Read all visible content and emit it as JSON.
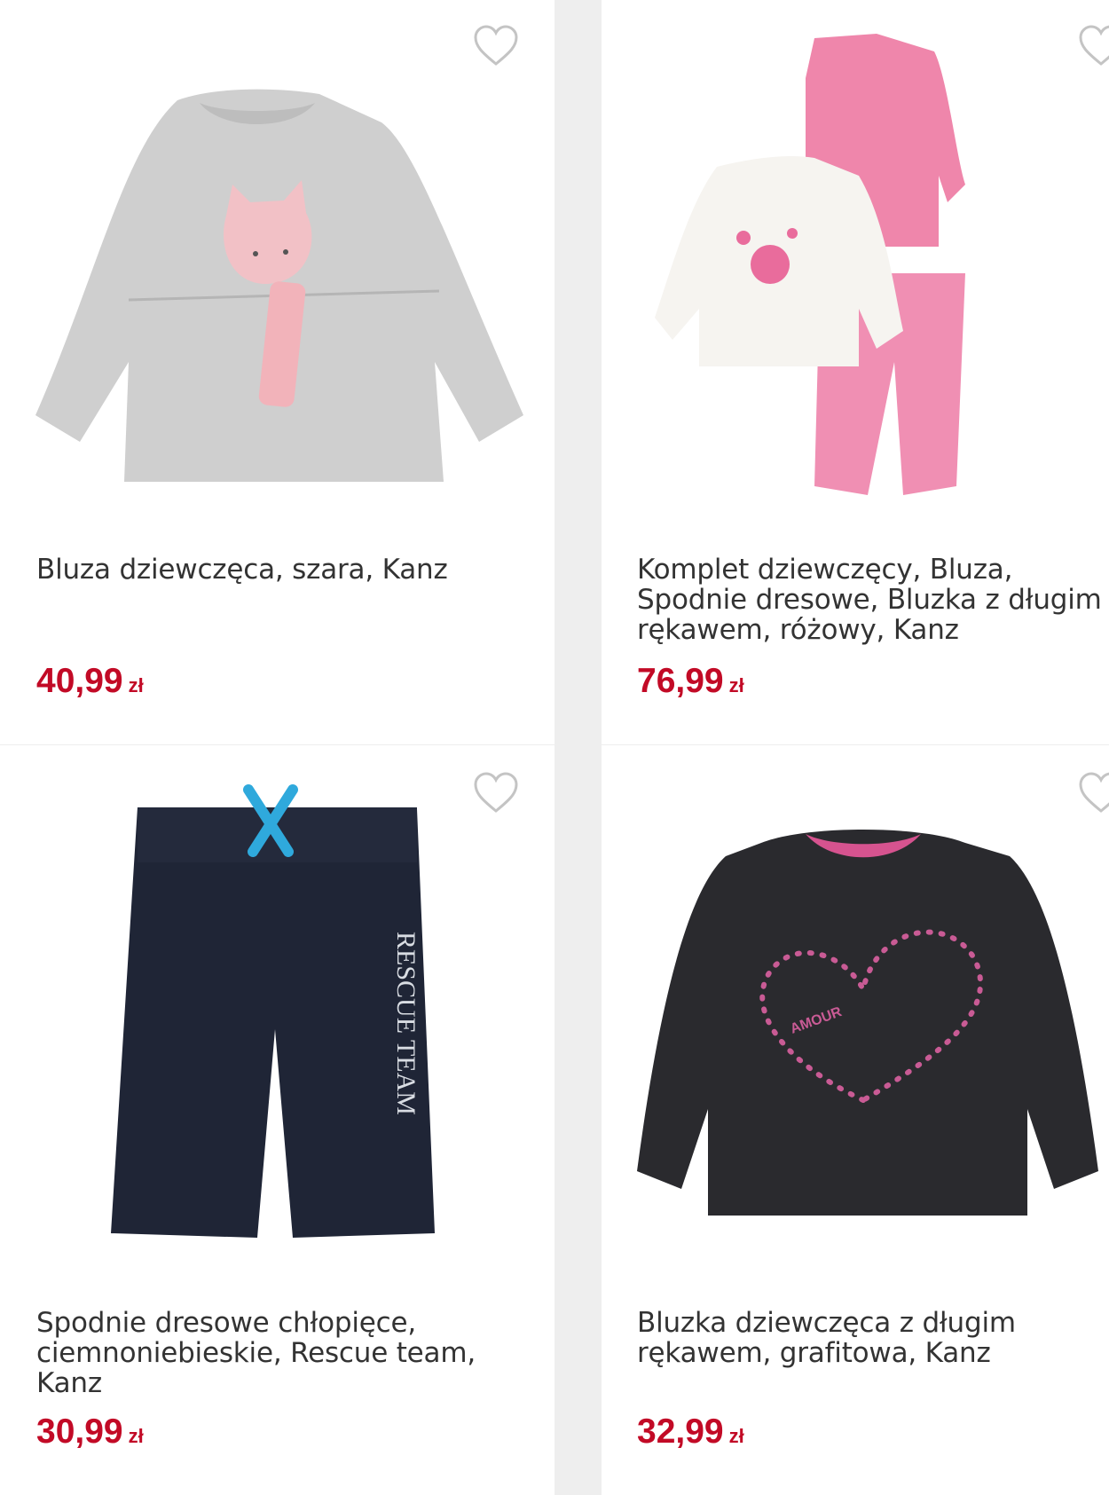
{
  "colors": {
    "price": "#c20a26",
    "title": "#333333",
    "background": "#eeeeee"
  },
  "products": [
    {
      "title": "Bluza dziewczęca, szara, Kanz",
      "price": "40,99",
      "currency": "zł",
      "image": "grey-cat-sweatshirt",
      "favorite_icon": "heart-outline-icon"
    },
    {
      "title": "Komplet dziewczęcy, Bluza, Spodnie dresowe, Bluzka z długim rękawem, różowy, Kanz",
      "price": "76,99",
      "currency": "zł",
      "image": "pink-white-set",
      "favorite_icon": "heart-outline-icon"
    },
    {
      "title": "Spodnie dresowe chłopięce, ciemnoniebieskie, Rescue team, Kanz",
      "price": "30,99",
      "currency": "zł",
      "image": "navy-sweatpants",
      "print_text": "RESCUE TEAM",
      "favorite_icon": "heart-outline-icon"
    },
    {
      "title": "Bluzka dziewczęca z długim rękawem, grafitowa, Kanz",
      "price": "32,99",
      "currency": "zł",
      "image": "graphite-heart-top",
      "print_text": "AMOUR",
      "favorite_icon": "heart-outline-icon"
    }
  ]
}
